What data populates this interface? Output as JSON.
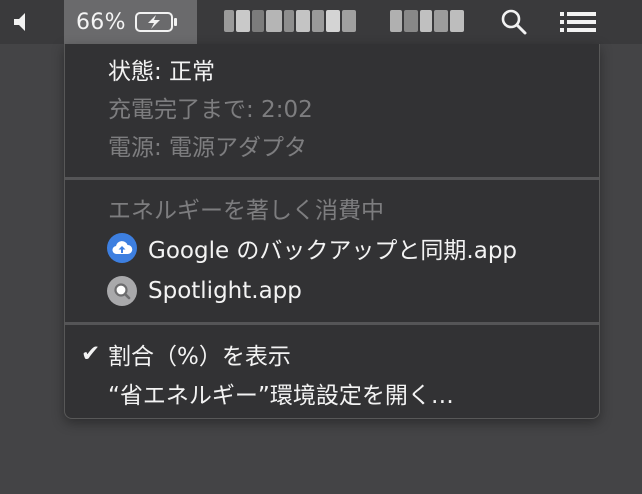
{
  "menubar": {
    "battery_percent": "66%",
    "icons": [
      "speaker-icon",
      "battery-charging-icon",
      "search-icon",
      "list-icon"
    ]
  },
  "battery_menu": {
    "status": "状態: 正常",
    "time_to_full": "充電完了まで: 2:02",
    "power_source": "電源: 電源アダプタ",
    "energy_header": "エネルギーを著しく消費中",
    "apps": [
      {
        "label": "Google のバックアップと同期.app",
        "icon": "google-backup-sync-icon",
        "color": "#3d7fe0"
      },
      {
        "label": "Spotlight.app",
        "icon": "spotlight-icon",
        "color": "#a9a9ab"
      }
    ],
    "show_percentage": "割合（%）を表示",
    "show_percentage_checked": true,
    "open_energy_saver": "“省エネルギー”環境設定を開く…"
  },
  "colors": {
    "menubar_bg": "#3a3a3c",
    "menu_bg": "#323234",
    "highlight": "#6a6a6c",
    "text_primary": "#f3f3f3",
    "text_secondary": "#7d7d7f"
  }
}
